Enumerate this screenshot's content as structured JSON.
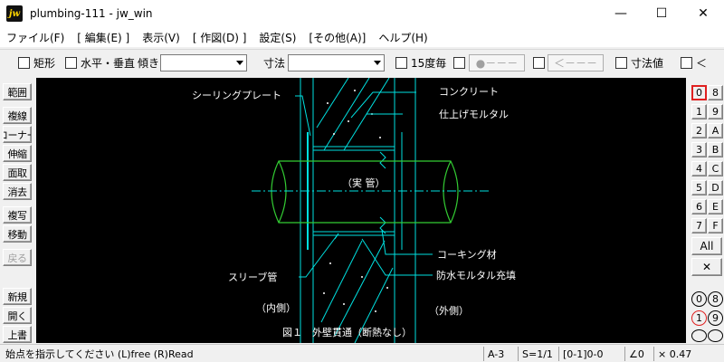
{
  "window": {
    "title": "plumbing-111 - jw_win",
    "icon": "jw-app-icon"
  },
  "menu": [
    "ファイル(F)",
    "[ 編集(E) ]",
    "表示(V)",
    "[ 作図(D) ]",
    "設定(S)",
    "[その他(A)]",
    "ヘルプ(H)"
  ],
  "toolbar": {
    "rect_label": "矩形",
    "hv_label": "水平・垂直",
    "tilt_label": "傾き",
    "tilt_value": "",
    "dim_label": "寸法",
    "dim_value": "",
    "step15_label": "15度毎",
    "btn_circle": "●－－－",
    "btn_arrow": "＜－－－",
    "dimval_label": "寸法値",
    "lt_label": "＜"
  },
  "left_tools": [
    "範囲",
    "複線",
    "コーナー",
    "伸縮",
    "面取",
    "消去",
    "複写",
    "移動",
    "戻る",
    "新規",
    "開く",
    "上書"
  ],
  "left_tools_disabled": [
    "戻る"
  ],
  "right_layers": {
    "left": [
      "0",
      "1",
      "2",
      "3",
      "4",
      "5",
      "6",
      "7"
    ],
    "right": [
      "8",
      "9",
      "A",
      "B",
      "C",
      "D",
      "E",
      "F"
    ],
    "all": "All",
    "groups_left": [
      "0",
      "1"
    ],
    "groups_right": [
      "8",
      "9"
    ],
    "active": "0",
    "active_group": "1"
  },
  "drawing": {
    "labels": {
      "sealing_plate": "シーリングプレート",
      "concrete": "コンクリート",
      "mortar_finish": "仕上げモルタル",
      "pipe": "（実 管）",
      "caulking": "コーキング材",
      "sleeve": "スリーブ管",
      "waterproof": "防水モルタル充填",
      "inside": "（内側）",
      "outside": "（外側）",
      "caption": "図１　外壁貫通（断熱なし）"
    },
    "colors": {
      "pipe": "#33cc33",
      "wall": "#00e0e0",
      "text": "#ffffff",
      "hatch": "#ffffff"
    }
  },
  "status": {
    "message": "始点を指示してください (L)free (R)Read",
    "paper": "A-3",
    "scale": "S=1/1",
    "layer": "[0-1]0-0",
    "angle": "∠0",
    "factor": "× 0.47"
  }
}
